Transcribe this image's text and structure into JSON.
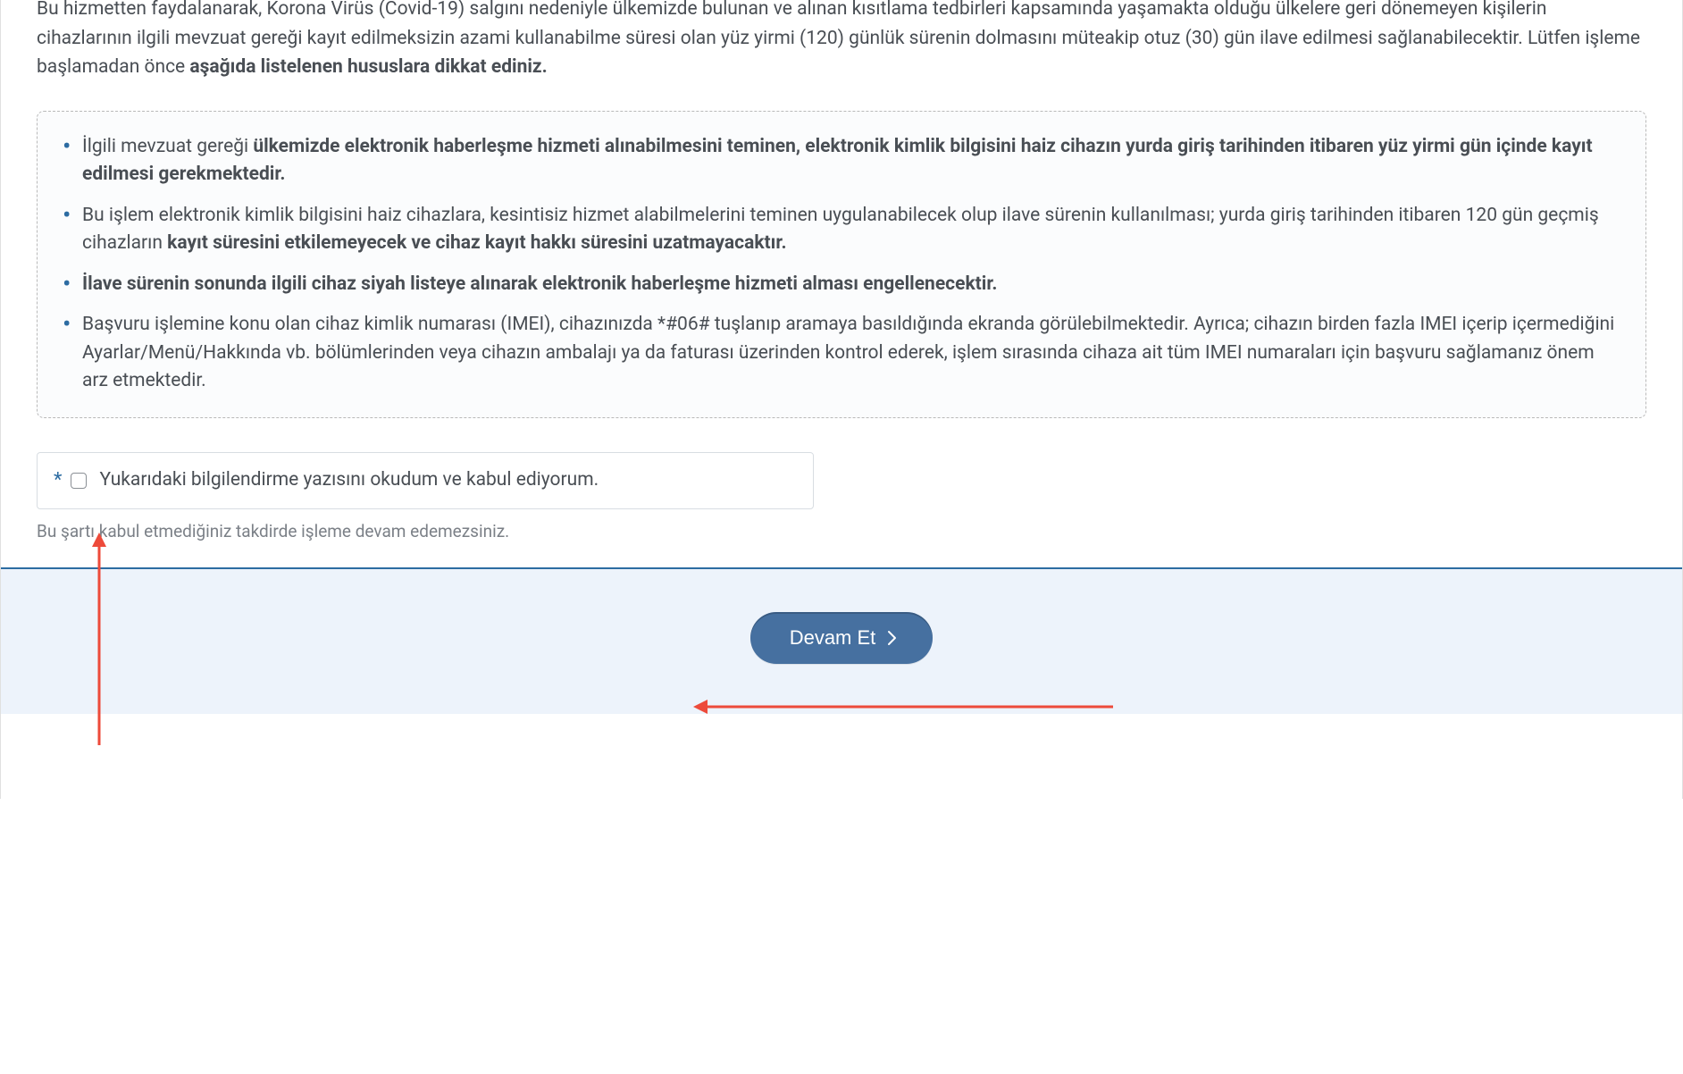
{
  "intro": {
    "part1_plain": "Bu hizmetten faydalanarak, Korona Virüs (Covid-19) salgını nedeniyle ülkemizde bulunan ve alınan kısıtlama tedbirleri kapsamında yaşamakta olduğu ülkelere geri dönemeyen kişilerin cihazlarının ilgili mevzuat gereği kayıt edilmeksizin azami kullanabilme süresi olan yüz yirmi (120) günlük sürenin dolmasını müteakip otuz (30) gün ilave edilmesi sağlanabilecektir. Lütfen işleme başlamadan önce ",
    "part2_bold": "aşağıda listelenen hususlara dikkat ediniz."
  },
  "info_items": [
    {
      "p1_plain": "İlgili mevzuat gereği ",
      "p2_bold": "ülkemizde elektronik haberleşme hizmeti alınabilmesini teminen, elektronik kimlik bilgisini haiz cihazın yurda giriş tarihinden itibaren yüz yirmi gün içinde kayıt edilmesi gerekmektedir.",
      "p3_plain": "",
      "p4_bold": "",
      "p5_plain": ""
    },
    {
      "p1_plain": "Bu işlem elektronik kimlik bilgisini haiz cihazlara, kesintisiz hizmet alabilmelerini teminen uygulanabilecek olup ilave sürenin kullanılması; yurda giriş tarihinden itibaren 120 gün geçmiş cihazların ",
      "p2_bold": "kayıt süresini etkilemeyecek ve cihaz kayıt hakkı süresini uzatmayacaktır.",
      "p3_plain": "",
      "p4_bold": "",
      "p5_plain": ""
    },
    {
      "p1_plain": "",
      "p2_bold": "İlave sürenin sonunda ilgili cihaz siyah listeye alınarak elektronik haberleşme hizmeti alması engellenecektir.",
      "p3_plain": "",
      "p4_bold": "",
      "p5_plain": ""
    },
    {
      "p1_plain": "Başvuru işlemine konu olan cihaz kimlik numarası (IMEI), cihazınızda *#06# tuşlanıp aramaya basıldığında ekranda görülebilmektedir. Ayrıca; cihazın birden fazla IMEI içerip içermediğini Ayarlar/Menü/Hakkında vb. bölümlerinden veya cihazın ambalajı ya da faturası üzerinden kontrol ederek, işlem sırasında cihaza ait tüm IMEI numaraları için başvuru sağlamanız önem arz etmektedir.",
      "p2_bold": "",
      "p3_plain": "",
      "p4_bold": "",
      "p5_plain": ""
    }
  ],
  "consent": {
    "asterisk": "*",
    "label": "Yukarıdaki bilgilendirme yazısını okudum ve kabul ediyorum.",
    "hint": "Bu şartı kabul etmediğiniz takdirde işleme devam edemezsiniz."
  },
  "actions": {
    "continue_label": "Devam Et"
  },
  "colors": {
    "accent": "#2d6ca2",
    "annotation_arrow": "#ed4a3a"
  }
}
